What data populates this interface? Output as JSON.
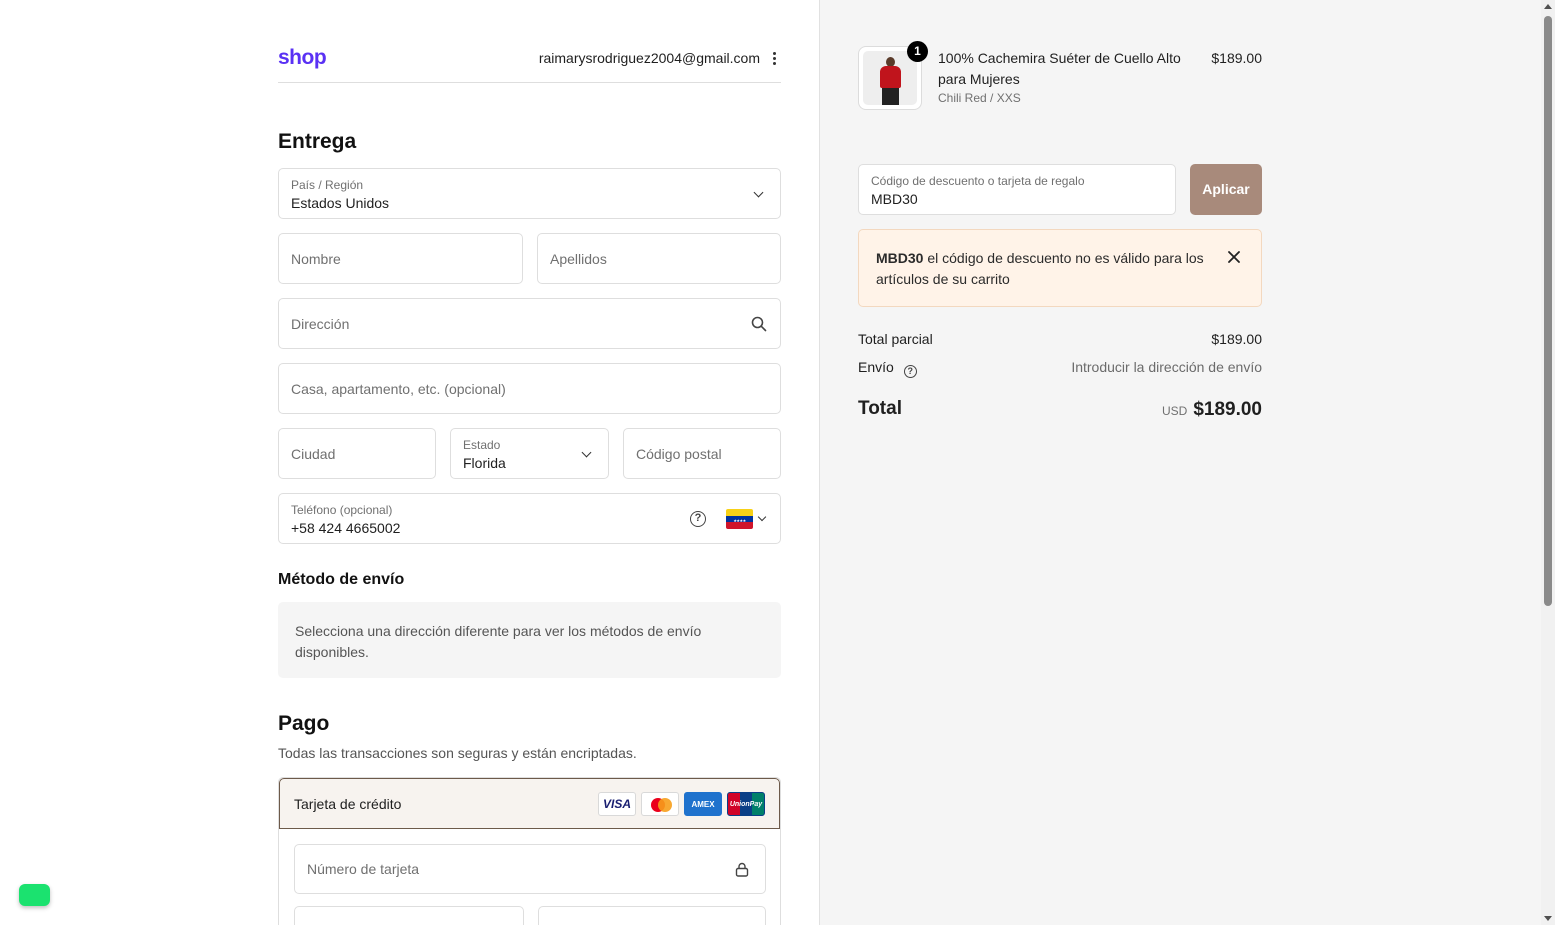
{
  "header": {
    "logo": "shop",
    "email": "raimarysrodriguez2004@gmail.com"
  },
  "delivery": {
    "title": "Entrega",
    "country": {
      "label": "País / Región",
      "value": "Estados Unidos"
    },
    "first_name_placeholder": "Nombre",
    "last_name_placeholder": "Apellidos",
    "address_placeholder": "Dirección",
    "apartment_placeholder": "Casa, apartamento, etc. (opcional)",
    "city_placeholder": "Ciudad",
    "state": {
      "label": "Estado",
      "value": "Florida"
    },
    "postal_placeholder": "Código postal",
    "phone": {
      "label": "Teléfono (opcional)",
      "value": "+58 424 4665002",
      "help": "?"
    }
  },
  "shipping": {
    "title": "Método de envío",
    "message": "Selecciona una dirección diferente para ver los métodos de envío disponibles."
  },
  "payment": {
    "title": "Pago",
    "description": "Todas las transacciones son seguras y están encriptadas.",
    "method_label": "Tarjeta de crédito",
    "cards": [
      "VISA",
      "",
      "AMEX",
      "UnionPay"
    ],
    "card_number_placeholder": "Número de tarjeta"
  },
  "cart": {
    "item": {
      "quantity": "1",
      "title": "100% Cachemira Suéter de Cuello Alto para Mujeres",
      "variant": "Chili Red / XXS",
      "price": "$189.00"
    },
    "discount": {
      "label": "Código de descuento o tarjeta de regalo",
      "value": "MBD30",
      "button": "Aplicar"
    },
    "alert": {
      "code": "MBD30",
      "message": " el código de descuento no es válido para los artículos de su carrito"
    },
    "subtotal": {
      "label": "Total parcial",
      "value": "$189.00"
    },
    "shipping": {
      "label": "Envío",
      "help": "?",
      "value": "Introducir la dirección de envío"
    },
    "total": {
      "label": "Total",
      "currency": "USD",
      "value": "$189.00"
    }
  }
}
